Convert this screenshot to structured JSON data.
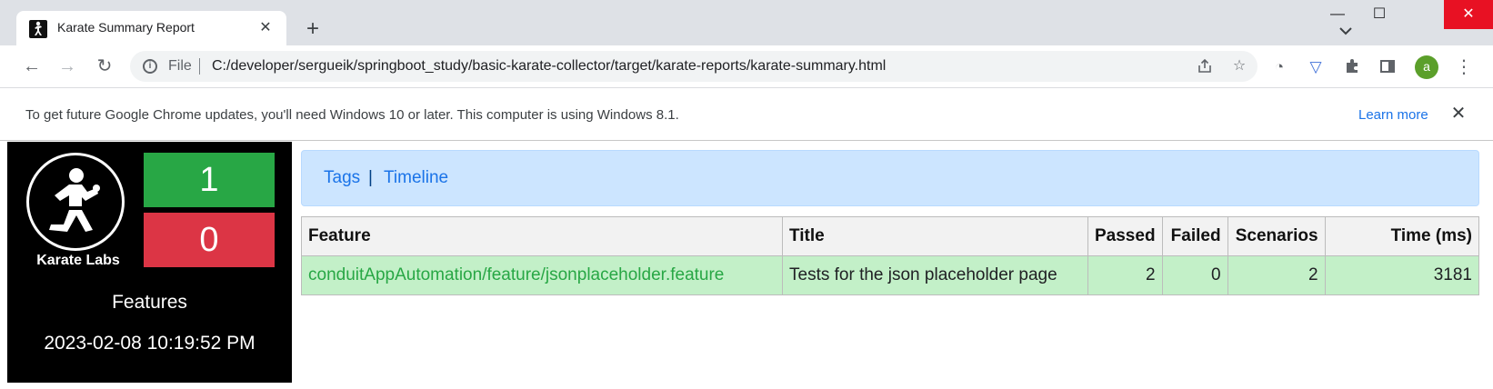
{
  "browser": {
    "tab_title": "Karate Summary Report",
    "tab_close": "✕",
    "new_tab": "+",
    "minimize": "—",
    "maximize": "☐",
    "close": "✕",
    "back": "←",
    "forward": "→",
    "reload": "↻",
    "file_label": "File",
    "url": "C:/developer/sergueik/springboot_study/basic-karate-collector/target/karate-reports/karate-summary.html",
    "avatar_letter": "a",
    "menu": "⋮"
  },
  "infobar": {
    "message": "To get future Google Chrome updates, you'll need Windows 10 or later. This computer is using Windows 8.1.",
    "learn_more": "Learn more",
    "close": "✕"
  },
  "sidebar": {
    "logo_label": "Karate Labs",
    "passed_count": "1",
    "failed_count": "0",
    "features_label": "Features",
    "date": "2023-02-08 10:19:52 PM",
    "colors": {
      "passed": "#28a745",
      "failed": "#dc3545"
    }
  },
  "nav": {
    "tags": "Tags",
    "separator": "|",
    "timeline": "Timeline"
  },
  "table": {
    "headers": {
      "feature": "Feature",
      "title": "Title",
      "passed": "Passed",
      "failed": "Failed",
      "scenarios": "Scenarios",
      "time": "Time (ms)"
    },
    "rows": [
      {
        "feature": "conduitAppAutomation/feature/jsonplaceholder.feature",
        "title": "Tests for the json placeholder page",
        "passed": "2",
        "failed": "0",
        "scenarios": "2",
        "time": "3181"
      }
    ]
  }
}
